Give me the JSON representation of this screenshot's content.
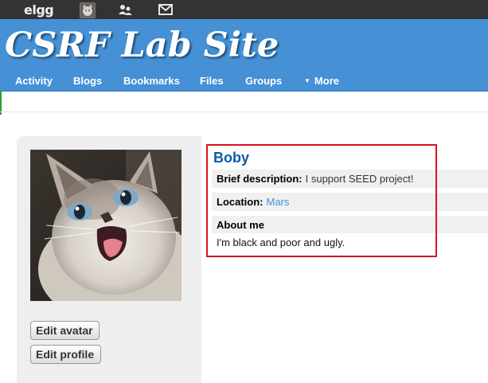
{
  "topbar": {
    "logo_text": "elgg",
    "avatar_icon": "user-avatar-icon",
    "friends_icon": "friends-icon",
    "messages_icon": "envelope-icon"
  },
  "header": {
    "site_title": "CSRF Lab Site",
    "nav": {
      "activity": "Activity",
      "blogs": "Blogs",
      "bookmarks": "Bookmarks",
      "files": "Files",
      "groups": "Groups",
      "more": "More"
    }
  },
  "profile": {
    "name": "Boby",
    "brief_label": "Brief description:",
    "brief_value": "I support SEED project!",
    "location_label": "Location:",
    "location_value": "Mars",
    "about_label": "About me",
    "about_value": "I'm black and poor and ugly.",
    "edit_avatar": "Edit avatar",
    "edit_profile": "Edit profile"
  },
  "colors": {
    "header_blue": "#4690d6",
    "name_blue": "#0d5aa7",
    "highlight_red": "#d9141b",
    "topbar": "#333333"
  }
}
